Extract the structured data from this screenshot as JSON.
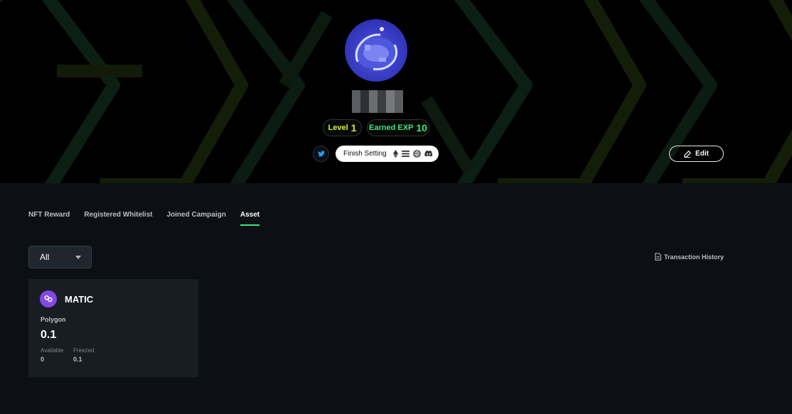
{
  "profile": {
    "level_label": "Level",
    "level_value": "1",
    "exp_label": "Earned EXP",
    "exp_value": "10",
    "finish_setting_label": "Finish Setting",
    "edit_label": "Edit"
  },
  "tabs": [
    {
      "label": "NFT Reward",
      "active": false
    },
    {
      "label": "Registered Whitelist",
      "active": false
    },
    {
      "label": "Joined Campaign",
      "active": false
    },
    {
      "label": "Asset",
      "active": true
    }
  ],
  "filter": {
    "selected": "All"
  },
  "transaction_history_label": "Transaction History",
  "assets": [
    {
      "token": "MATIC",
      "network": "Polygon",
      "amount": "0.1",
      "available_label": "Available",
      "available_value": "0",
      "freezed_label": "Freezed",
      "freezed_value": "0.1"
    }
  ],
  "colors": {
    "background": "#0c1015",
    "accent_green": "#3ee680",
    "level_yellow": "#d5ef2b",
    "matic_purple": "#8247e5"
  },
  "icons": [
    "twitter-icon",
    "ethereum-icon",
    "list-icon",
    "globe-icon",
    "discord-icon",
    "pencil-icon",
    "document-icon",
    "polygon-icon",
    "chevron-down-icon"
  ]
}
